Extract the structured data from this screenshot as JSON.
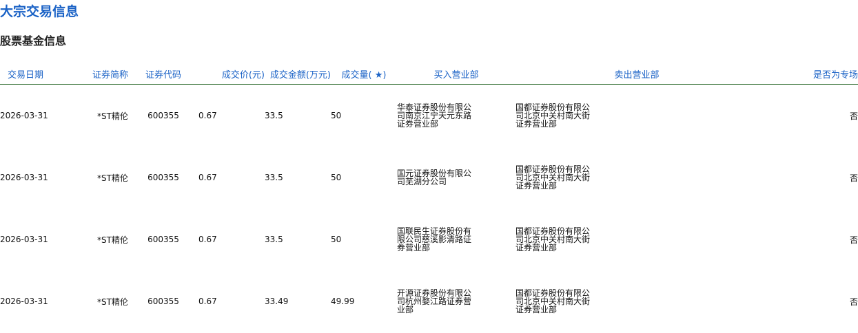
{
  "page": {
    "title": "大宗交易信息",
    "subtitle": "股票基金信息"
  },
  "table": {
    "headers": {
      "date": "交易日期",
      "name": "证券简称",
      "code": "证券代码",
      "price": "成交价(元)",
      "amount": "成交金额(万元)",
      "volume": "成交量( ★)",
      "buyer": "买入营业部",
      "seller": "卖出营业部",
      "flag": "是否为专场"
    },
    "rows": [
      {
        "date": "2026-03-31",
        "name": "*ST精伦",
        "code": "600355",
        "price": "0.67",
        "amount": "33.5",
        "volume": "50",
        "buyer": "华泰证券股份有限公司南京江宁天元东路证券营业部",
        "seller": "国都证券股份有限公司北京中关村南大街证券营业部",
        "flag": "否"
      },
      {
        "date": "2026-03-31",
        "name": "*ST精伦",
        "code": "600355",
        "price": "0.67",
        "amount": "33.5",
        "volume": "50",
        "buyer": "国元证券股份有限公司芜湖分公司",
        "seller": "国都证券股份有限公司北京中关村南大街证券营业部",
        "flag": "否"
      },
      {
        "date": "2026-03-31",
        "name": "*ST精伦",
        "code": "600355",
        "price": "0.67",
        "amount": "33.5",
        "volume": "50",
        "buyer": "国联民生证券股份有限公司慈溪影清路证券营业部",
        "seller": "国都证券股份有限公司北京中关村南大街证券营业部",
        "flag": "否"
      },
      {
        "date": "2026-03-31",
        "name": "*ST精伦",
        "code": "600355",
        "price": "0.67",
        "amount": "33.49",
        "volume": "49.99",
        "buyer": "开源证券股份有限公司杭州婺江路证券营业部",
        "seller": "国都证券股份有限公司北京中关村南大街证券营业部",
        "flag": "否"
      }
    ]
  },
  "colors": {
    "title": "#1a62c6",
    "header_text": "#1a62c6",
    "header_rule": "#2c6a2c",
    "body_text": "#111111"
  }
}
